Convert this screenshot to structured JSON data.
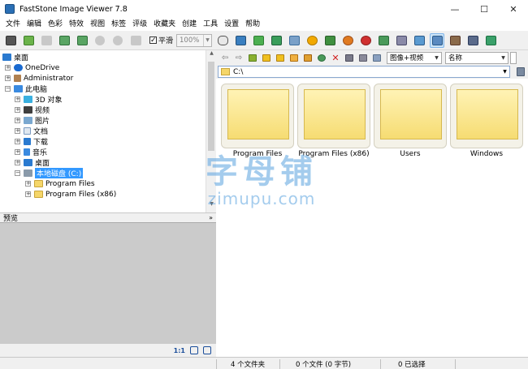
{
  "window": {
    "title": "FastStone Image Viewer 7.8",
    "minimize": "—",
    "maximize": "☐",
    "close": "✕"
  },
  "menu": [
    "文件",
    "编辑",
    "色彩",
    "特效",
    "视图",
    "标签",
    "评级",
    "收藏夹",
    "创建",
    "工具",
    "设置",
    "帮助"
  ],
  "toolbar": {
    "smooth_label": "平滑",
    "smooth_checked": "✓",
    "zoom_value": "100%"
  },
  "tree": {
    "desktop": "桌面",
    "onedrive": "OneDrive",
    "administrator": "Administrator",
    "thispc": "此电脑",
    "objects3d": "3D 对象",
    "videos": "视频",
    "pictures": "图片",
    "documents": "文档",
    "downloads": "下载",
    "music": "音乐",
    "desktop2": "桌面",
    "localdisk": "本地磁盘 (C:)",
    "programfiles": "Program Files",
    "programfilesx86": "Program Files (x86)"
  },
  "preview": {
    "title": "预览",
    "ratio": "1:1"
  },
  "nav": {
    "filter": "图像+视频",
    "sort": "名称"
  },
  "path": "C:\\",
  "folders": [
    "Program Files",
    "Program Files (x86)",
    "Users",
    "Windows"
  ],
  "status": {
    "folders": "4 个文件夹",
    "files": "0 个文件 (0 字节)",
    "selected": "0 已选择"
  },
  "watermark": {
    "line1": "字母铺",
    "line2": "zimupu.com"
  },
  "colors": {
    "accent": "#3399ff",
    "folder": "#f6dc72"
  }
}
